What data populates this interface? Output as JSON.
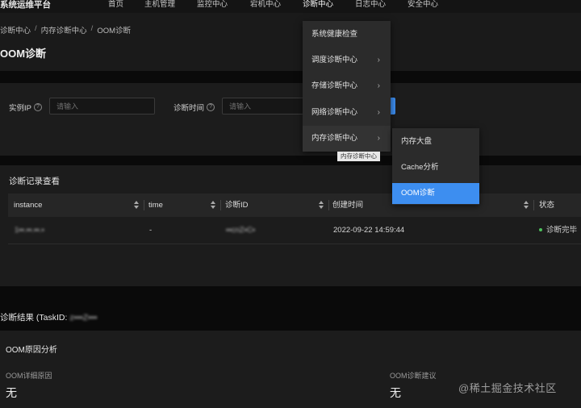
{
  "app": {
    "title": "系统运维平台"
  },
  "nav": {
    "items": [
      {
        "label": "首页"
      },
      {
        "label": "主机管理"
      },
      {
        "label": "监控中心"
      },
      {
        "label": "宕机中心"
      },
      {
        "label": "诊断中心"
      },
      {
        "label": "日志中心"
      },
      {
        "label": "安全中心"
      }
    ],
    "active": "诊断中心"
  },
  "breadcrumb": {
    "items": [
      "诊断中心",
      "内存诊断中心",
      "OOM诊断"
    ],
    "separator": "/"
  },
  "page": {
    "title": "OOM诊断"
  },
  "filters": {
    "instance_ip": {
      "label": "实例IP",
      "placeholder": "请输入"
    },
    "diagnose_time": {
      "label": "诊断时间",
      "placeholder": "请输入"
    },
    "help_glyph": "?"
  },
  "records": {
    "title": "诊断记录查看",
    "columns": [
      "instance",
      "time",
      "诊断ID",
      "创建时间",
      "状态"
    ],
    "rows": [
      {
        "instance": "1▪▪.▪▪.▪▪.▪",
        "time": "-",
        "diag_id": "▪▪cnZ▪C▪",
        "created": "2022-09-22 14:59:44",
        "status": "诊断完毕"
      }
    ]
  },
  "result": {
    "title_prefix": "诊断结果 (TaskID: ",
    "task_id": "z▪▪▪Z▪▪▪",
    "section": "OOM原因分析",
    "detail_label": "OOM详细原因",
    "detail_value": "无",
    "advice_label": "OOM诊断建议",
    "advice_value": "无"
  },
  "dropdown": {
    "items": [
      {
        "label": "系统健康检查",
        "has_sub": false
      },
      {
        "label": "调度诊断中心",
        "has_sub": true
      },
      {
        "label": "存储诊断中心",
        "has_sub": true
      },
      {
        "label": "网络诊断中心",
        "has_sub": true
      },
      {
        "label": "内存诊断中心",
        "has_sub": true
      }
    ],
    "submenu": [
      {
        "label": "内存大盘"
      },
      {
        "label": "Cache分析"
      },
      {
        "label": "OOM诊断"
      }
    ],
    "selected_sub": "OOM诊断",
    "tooltip": "内存诊断中心",
    "chevron": "›"
  },
  "watermark": "@稀土掘金技术社区",
  "colors": {
    "accent": "#3d8ef0",
    "status_ok": "#4cc15c",
    "background": "#1a1a1a"
  }
}
